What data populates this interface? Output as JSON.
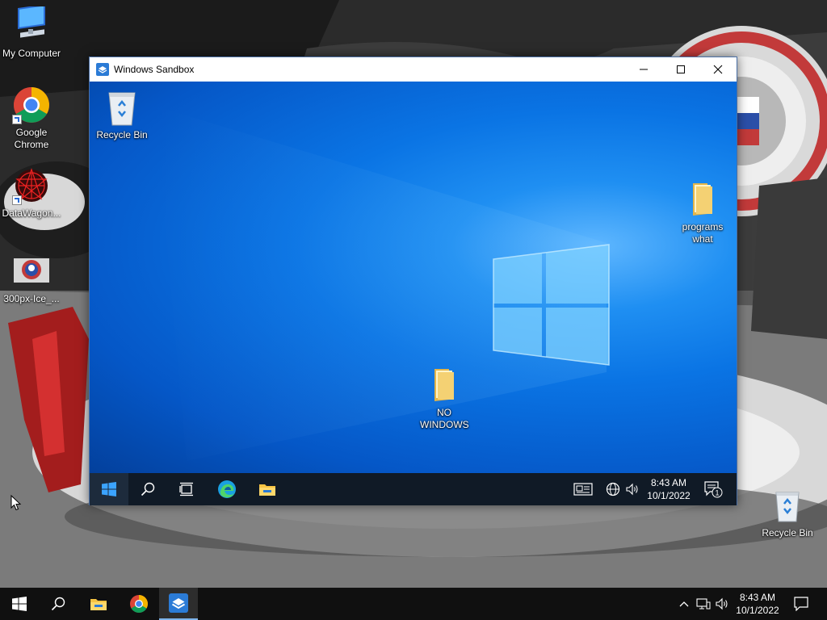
{
  "host_desktop": {
    "icons": [
      {
        "label": "My Computer",
        "icon": "monitor-icon"
      },
      {
        "label": "Google Chrome",
        "icon": "chrome-icon"
      },
      {
        "label": "DataWagon...",
        "icon": "datawagon-icon"
      },
      {
        "label": "300px-Ice_...",
        "icon": "image-thumbnail-icon"
      },
      {
        "label": "Recycle Bin",
        "icon": "recycle-bin-icon"
      }
    ]
  },
  "sandbox": {
    "title": "Windows Sandbox",
    "desktop_icons": [
      {
        "label": "Recycle Bin",
        "icon": "recycle-bin-icon"
      },
      {
        "label": "programs what",
        "icon": "folder-icon"
      },
      {
        "label": "NO WINDOWS",
        "icon": "folder-icon"
      }
    ],
    "taskbar": {
      "items": [
        "start-icon",
        "search-icon",
        "task-view-icon",
        "edge-icon",
        "file-explorer-icon"
      ],
      "tray": [
        "news-icon",
        "network-globe-icon",
        "volume-icon"
      ],
      "time": "8:43 AM",
      "date": "10/1/2022",
      "notification_count": "1"
    }
  },
  "host_taskbar": {
    "items": [
      "start-icon",
      "search-icon",
      "file-explorer-icon",
      "chrome-icon",
      "windows-sandbox-icon"
    ],
    "tray": [
      "chevron-up-icon",
      "network-icon",
      "volume-icon"
    ],
    "time": "8:43 AM",
    "date": "10/1/2022"
  },
  "colors": {
    "sandbox_taskbar": "#101a26",
    "host_taskbar": "#101010",
    "desktop_blue": "#0a74e4",
    "active_indicator": "#7eb4ea"
  }
}
